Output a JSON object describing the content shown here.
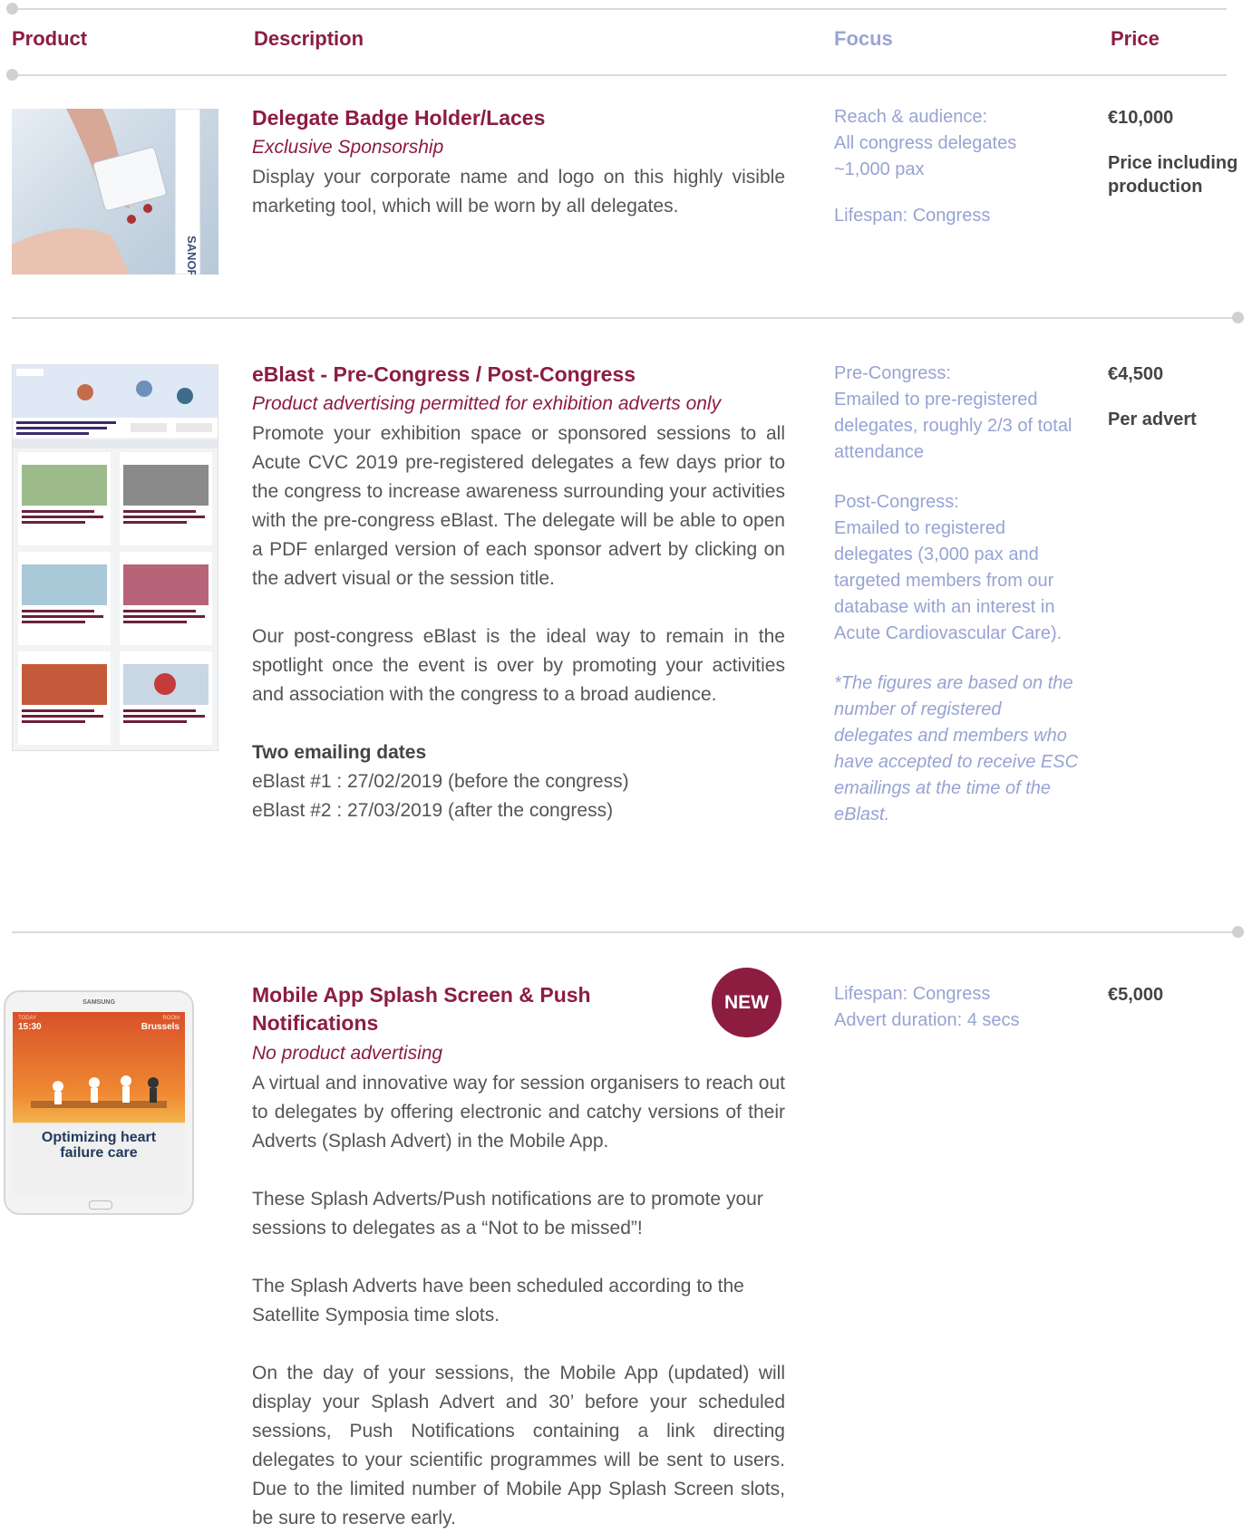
{
  "header": {
    "product": "Product",
    "description": "Description",
    "focus": "Focus",
    "price": "Price"
  },
  "items": [
    {
      "title": "Delegate Badge Holder/Laces",
      "subtitle": "Exclusive Sponsorship",
      "description": [
        "Display your corporate name and logo on this highly visible marketing tool, which will be worn by all delegates."
      ],
      "focus": [
        "Reach & audience:\nAll congress delegates\n~1,000 pax",
        "Lifespan: Congress"
      ],
      "price": [
        "€10,000",
        "Price including production"
      ],
      "image": {
        "alt_text": "SANOFI"
      }
    },
    {
      "title": "eBlast - Pre-Congress / Post-Congress",
      "subtitle": "Product advertising permitted for exhibition adverts only",
      "description": [
        "Promote your exhibition space or sponsored sessions to all Acute CVC 2019 pre-registered delegates a few days prior to the congress to increase awareness surrounding your activities with the pre-congress eBlast. The delegate will be able to open a PDF enlarged version of each sponsor advert by clicking on the advert visual or the session title.",
        "Our post-congress eBlast is the ideal way to remain in the spotlight once the event is over by promoting your activities and association with the congress to a broad audience."
      ],
      "dates_title": "Two emailing dates",
      "dates": [
        "eBlast #1 : 27/02/2019 (before the congress)",
        "eBlast #2 : 27/03/2019 (after the congress)"
      ],
      "focus": [
        "Pre-Congress:\nEmailed to pre-registered delegates, roughly 2/3 of total attendance",
        "Post-Congress:\nEmailed to registered delegates (3,000 pax and targeted members from our database with an interest in Acute Cardiovascular Care)."
      ],
      "focus_note": "*The figures are based on the number of registered delegates and members who have accepted to receive ESC emailings at the time of the eBlast.",
      "price": [
        "€4,500",
        "Per advert"
      ]
    },
    {
      "title": "Mobile App Splash Screen & Push Notifications",
      "badge": "NEW",
      "subtitle": "No product advertising",
      "description": [
        "A virtual and innovative way for session organisers to reach out to delegates by offering electronic and catchy versions of their Adverts (Splash Advert) in the Mobile App.",
        "These Splash Adverts/Push notifications are to promote your sessions to delegates as a “Not to be missed”!",
        "The Splash Adverts have been scheduled according to the Satellite Symposia time slots.",
        "On the day of your sessions, the Mobile App (updated) will display your Splash Advert and 30’ before your scheduled sessions, Push Notifications containing a link directing delegates to your scientific programmes will be sent to users. Due to the limited number of Mobile App Splash Screen slots, be sure to reserve early."
      ],
      "focus": [
        "Lifespan: Congress\nAdvert duration: 4 secs"
      ],
      "price": [
        "€5,000"
      ],
      "tablet": {
        "brand": "SAMSUNG",
        "time": "15:30",
        "today": "TODAY",
        "room": "ROOM",
        "city": "Brussels",
        "headline": "Optimizing heart failure care"
      }
    }
  ],
  "colors": {
    "accent": "#8c1d40",
    "focus": "#97a3d3",
    "rule": "#d9d9d9"
  }
}
